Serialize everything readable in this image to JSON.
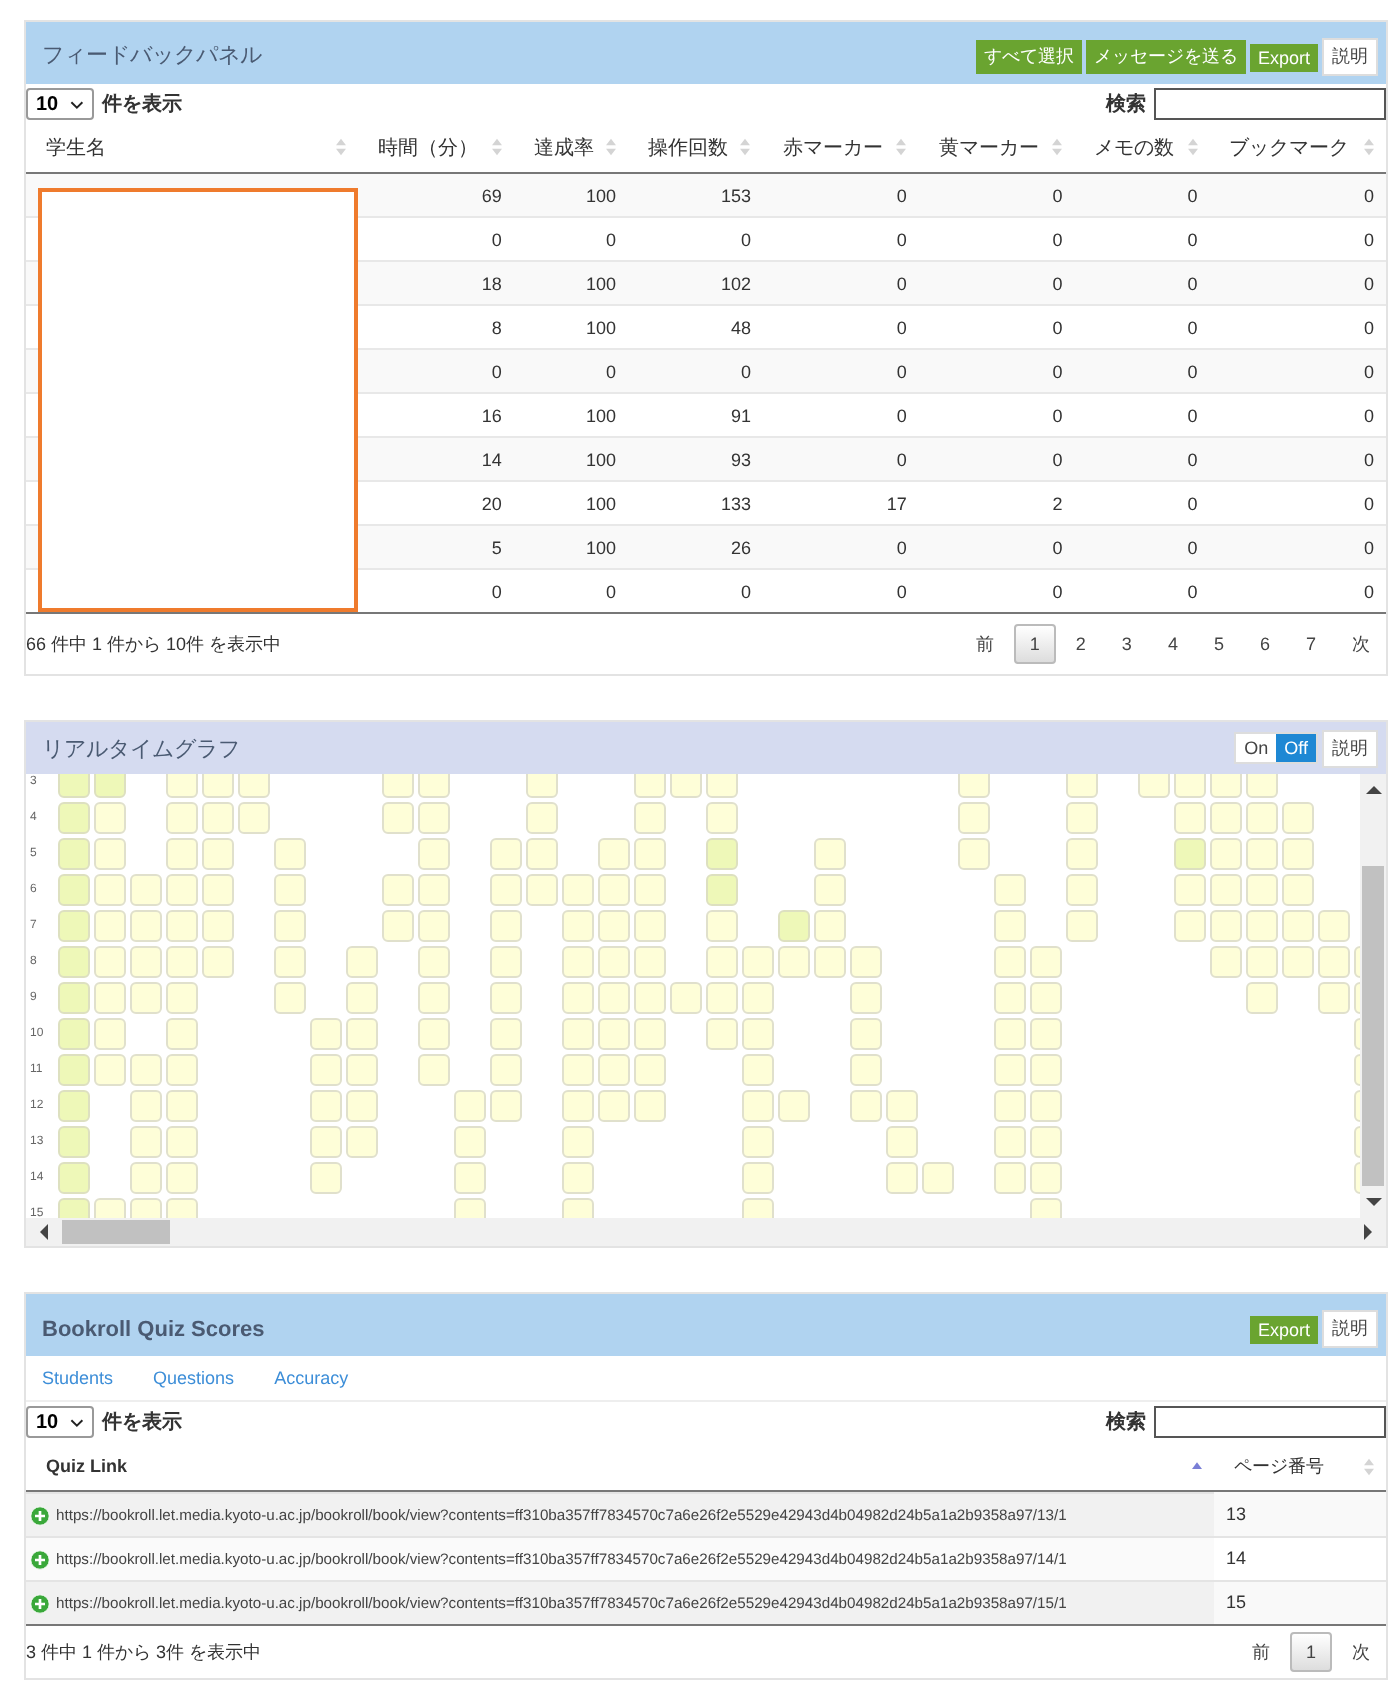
{
  "feedback": {
    "title": "フィードバックパネル",
    "buttons": [
      {
        "label": "すべて選択",
        "kind": "primary"
      },
      {
        "label": "メッセージを送る",
        "kind": "primary"
      },
      {
        "label": "Export",
        "kind": "primary"
      },
      {
        "label": "説明",
        "kind": "plain"
      }
    ],
    "length": {
      "value": "10",
      "label": "件を表示"
    },
    "search": {
      "label": "検索"
    },
    "columns": [
      "学生名",
      "時間（分）",
      "達成率",
      "操作回数",
      "赤マーカー",
      "黄マーカー",
      "メモの数",
      "ブックマーク"
    ],
    "rows": [
      [
        "",
        "69",
        "100",
        "153",
        "0",
        "0",
        "0",
        "0"
      ],
      [
        "",
        "0",
        "0",
        "0",
        "0",
        "0",
        "0",
        "0"
      ],
      [
        "",
        "18",
        "100",
        "102",
        "0",
        "0",
        "0",
        "0"
      ],
      [
        "",
        "8",
        "100",
        "48",
        "0",
        "0",
        "0",
        "0"
      ],
      [
        "",
        "0",
        "0",
        "0",
        "0",
        "0",
        "0",
        "0"
      ],
      [
        "",
        "16",
        "100",
        "91",
        "0",
        "0",
        "0",
        "0"
      ],
      [
        "",
        "14",
        "100",
        "93",
        "0",
        "0",
        "0",
        "0"
      ],
      [
        "",
        "20",
        "100",
        "133",
        "17",
        "2",
        "0",
        "0"
      ],
      [
        "",
        "5",
        "100",
        "26",
        "0",
        "0",
        "0",
        "0"
      ],
      [
        "",
        "0",
        "0",
        "0",
        "0",
        "0",
        "0",
        "0"
      ]
    ],
    "info": "66 件中 1 件から 10件 を表示中",
    "pages": [
      {
        "label": "前",
        "selected": false
      },
      {
        "label": "1",
        "selected": true
      },
      {
        "label": "2",
        "selected": false
      },
      {
        "label": "3",
        "selected": false
      },
      {
        "label": "4",
        "selected": false
      },
      {
        "label": "5",
        "selected": false
      },
      {
        "label": "6",
        "selected": false
      },
      {
        "label": "7",
        "selected": false
      },
      {
        "label": "次",
        "selected": false
      }
    ]
  },
  "graph": {
    "title": "リアルタイムグラフ",
    "toggle": [
      {
        "label": "On",
        "selected": false
      },
      {
        "label": "Off",
        "selected": true
      }
    ],
    "help": "説明",
    "rows": [
      {
        "label": "3",
        "cells": [
          {
            "kind": "lime"
          },
          {
            "kind": "lime"
          },
          {
            "kind": "none"
          },
          {
            "kind": "pale"
          },
          {
            "kind": "pale"
          },
          {
            "kind": "pale"
          },
          {
            "kind": "none"
          },
          {
            "kind": "none"
          },
          {
            "kind": "none"
          },
          {
            "kind": "pale"
          },
          {
            "kind": "pale"
          },
          {
            "kind": "none"
          },
          {
            "kind": "none"
          },
          {
            "kind": "pale"
          },
          {
            "kind": "none"
          },
          {
            "kind": "none"
          },
          {
            "kind": "pale"
          },
          {
            "kind": "pale"
          },
          {
            "kind": "pale"
          },
          {
            "kind": "none"
          },
          {
            "kind": "none"
          },
          {
            "kind": "none"
          },
          {
            "kind": "none"
          },
          {
            "kind": "none"
          },
          {
            "kind": "none"
          },
          {
            "kind": "pale"
          },
          {
            "kind": "none"
          },
          {
            "kind": "none"
          },
          {
            "kind": "pale"
          },
          {
            "kind": "none"
          },
          {
            "kind": "pale"
          },
          {
            "kind": "pale"
          },
          {
            "kind": "pale"
          },
          {
            "kind": "pale"
          },
          {
            "kind": "none"
          },
          {
            "kind": "none"
          },
          {
            "kind": "none"
          }
        ]
      },
      {
        "label": "4",
        "cells": [
          {
            "kind": "lime"
          },
          {
            "kind": "pale"
          },
          {
            "kind": "none"
          },
          {
            "kind": "pale"
          },
          {
            "kind": "pale"
          },
          {
            "kind": "pale"
          },
          {
            "kind": "none"
          },
          {
            "kind": "none"
          },
          {
            "kind": "none"
          },
          {
            "kind": "pale"
          },
          {
            "kind": "pale"
          },
          {
            "kind": "none"
          },
          {
            "kind": "none"
          },
          {
            "kind": "pale"
          },
          {
            "kind": "none"
          },
          {
            "kind": "none"
          },
          {
            "kind": "pale"
          },
          {
            "kind": "none"
          },
          {
            "kind": "pale"
          },
          {
            "kind": "none"
          },
          {
            "kind": "none"
          },
          {
            "kind": "none"
          },
          {
            "kind": "none"
          },
          {
            "kind": "none"
          },
          {
            "kind": "none"
          },
          {
            "kind": "pale"
          },
          {
            "kind": "none"
          },
          {
            "kind": "none"
          },
          {
            "kind": "pale"
          },
          {
            "kind": "none"
          },
          {
            "kind": "none"
          },
          {
            "kind": "pale"
          },
          {
            "kind": "pale"
          },
          {
            "kind": "pale"
          },
          {
            "kind": "pale"
          },
          {
            "kind": "none"
          },
          {
            "kind": "none"
          }
        ]
      },
      {
        "label": "5",
        "cells": [
          {
            "kind": "lime"
          },
          {
            "kind": "pale"
          },
          {
            "kind": "none"
          },
          {
            "kind": "pale"
          },
          {
            "kind": "pale"
          },
          {
            "kind": "none"
          },
          {
            "kind": "pale"
          },
          {
            "kind": "none"
          },
          {
            "kind": "none"
          },
          {
            "kind": "none"
          },
          {
            "kind": "pale"
          },
          {
            "kind": "none"
          },
          {
            "kind": "pale"
          },
          {
            "kind": "pale"
          },
          {
            "kind": "none"
          },
          {
            "kind": "pale"
          },
          {
            "kind": "pale"
          },
          {
            "kind": "none"
          },
          {
            "kind": "lime"
          },
          {
            "kind": "none"
          },
          {
            "kind": "none"
          },
          {
            "kind": "pale"
          },
          {
            "kind": "none"
          },
          {
            "kind": "none"
          },
          {
            "kind": "none"
          },
          {
            "kind": "pale"
          },
          {
            "kind": "none"
          },
          {
            "kind": "none"
          },
          {
            "kind": "pale"
          },
          {
            "kind": "none"
          },
          {
            "kind": "none"
          },
          {
            "kind": "lime"
          },
          {
            "kind": "pale"
          },
          {
            "kind": "pale"
          },
          {
            "kind": "pale"
          },
          {
            "kind": "none"
          },
          {
            "kind": "none"
          }
        ]
      },
      {
        "label": "6",
        "cells": [
          {
            "kind": "lime"
          },
          {
            "kind": "pale"
          },
          {
            "kind": "pale"
          },
          {
            "kind": "pale"
          },
          {
            "kind": "pale"
          },
          {
            "kind": "none"
          },
          {
            "kind": "pale"
          },
          {
            "kind": "none"
          },
          {
            "kind": "none"
          },
          {
            "kind": "pale"
          },
          {
            "kind": "pale"
          },
          {
            "kind": "none"
          },
          {
            "kind": "pale"
          },
          {
            "kind": "pale"
          },
          {
            "kind": "pale"
          },
          {
            "kind": "pale"
          },
          {
            "kind": "pale"
          },
          {
            "kind": "none"
          },
          {
            "kind": "lime"
          },
          {
            "kind": "none"
          },
          {
            "kind": "none"
          },
          {
            "kind": "pale"
          },
          {
            "kind": "none"
          },
          {
            "kind": "none"
          },
          {
            "kind": "none"
          },
          {
            "kind": "none"
          },
          {
            "kind": "pale"
          },
          {
            "kind": "none"
          },
          {
            "kind": "pale"
          },
          {
            "kind": "none"
          },
          {
            "kind": "none"
          },
          {
            "kind": "pale"
          },
          {
            "kind": "pale"
          },
          {
            "kind": "pale"
          },
          {
            "kind": "pale"
          },
          {
            "kind": "none"
          },
          {
            "kind": "none"
          }
        ]
      },
      {
        "label": "7",
        "cells": [
          {
            "kind": "lime"
          },
          {
            "kind": "pale"
          },
          {
            "kind": "pale"
          },
          {
            "kind": "pale"
          },
          {
            "kind": "pale"
          },
          {
            "kind": "none"
          },
          {
            "kind": "pale"
          },
          {
            "kind": "none"
          },
          {
            "kind": "none"
          },
          {
            "kind": "pale"
          },
          {
            "kind": "pale"
          },
          {
            "kind": "none"
          },
          {
            "kind": "pale"
          },
          {
            "kind": "none"
          },
          {
            "kind": "pale"
          },
          {
            "kind": "pale"
          },
          {
            "kind": "pale"
          },
          {
            "kind": "none"
          },
          {
            "kind": "pale"
          },
          {
            "kind": "none"
          },
          {
            "kind": "lime"
          },
          {
            "kind": "pale"
          },
          {
            "kind": "none"
          },
          {
            "kind": "none"
          },
          {
            "kind": "none"
          },
          {
            "kind": "none"
          },
          {
            "kind": "pale"
          },
          {
            "kind": "none"
          },
          {
            "kind": "pale"
          },
          {
            "kind": "none"
          },
          {
            "kind": "none"
          },
          {
            "kind": "pale"
          },
          {
            "kind": "pale"
          },
          {
            "kind": "pale"
          },
          {
            "kind": "pale"
          },
          {
            "kind": "pale"
          },
          {
            "kind": "none"
          }
        ]
      },
      {
        "label": "8",
        "cells": [
          {
            "kind": "lime"
          },
          {
            "kind": "pale"
          },
          {
            "kind": "pale"
          },
          {
            "kind": "pale"
          },
          {
            "kind": "pale"
          },
          {
            "kind": "none"
          },
          {
            "kind": "pale"
          },
          {
            "kind": "none"
          },
          {
            "kind": "pale"
          },
          {
            "kind": "none"
          },
          {
            "kind": "pale"
          },
          {
            "kind": "none"
          },
          {
            "kind": "pale"
          },
          {
            "kind": "none"
          },
          {
            "kind": "pale"
          },
          {
            "kind": "pale"
          },
          {
            "kind": "pale"
          },
          {
            "kind": "none"
          },
          {
            "kind": "pale"
          },
          {
            "kind": "pale"
          },
          {
            "kind": "pale"
          },
          {
            "kind": "pale"
          },
          {
            "kind": "pale"
          },
          {
            "kind": "none"
          },
          {
            "kind": "none"
          },
          {
            "kind": "none"
          },
          {
            "kind": "pale"
          },
          {
            "kind": "pale"
          },
          {
            "kind": "none"
          },
          {
            "kind": "none"
          },
          {
            "kind": "none"
          },
          {
            "kind": "none"
          },
          {
            "kind": "pale"
          },
          {
            "kind": "pale"
          },
          {
            "kind": "pale"
          },
          {
            "kind": "pale"
          },
          {
            "kind": "pale"
          }
        ]
      },
      {
        "label": "9",
        "cells": [
          {
            "kind": "lime"
          },
          {
            "kind": "pale"
          },
          {
            "kind": "pale"
          },
          {
            "kind": "pale"
          },
          {
            "kind": "none"
          },
          {
            "kind": "none"
          },
          {
            "kind": "pale"
          },
          {
            "kind": "none"
          },
          {
            "kind": "pale"
          },
          {
            "kind": "none"
          },
          {
            "kind": "pale"
          },
          {
            "kind": "none"
          },
          {
            "kind": "pale"
          },
          {
            "kind": "none"
          },
          {
            "kind": "pale"
          },
          {
            "kind": "pale"
          },
          {
            "kind": "pale"
          },
          {
            "kind": "pale"
          },
          {
            "kind": "pale"
          },
          {
            "kind": "pale"
          },
          {
            "kind": "none"
          },
          {
            "kind": "none"
          },
          {
            "kind": "pale"
          },
          {
            "kind": "none"
          },
          {
            "kind": "none"
          },
          {
            "kind": "none"
          },
          {
            "kind": "pale"
          },
          {
            "kind": "pale"
          },
          {
            "kind": "none"
          },
          {
            "kind": "none"
          },
          {
            "kind": "none"
          },
          {
            "kind": "none"
          },
          {
            "kind": "none"
          },
          {
            "kind": "pale"
          },
          {
            "kind": "none"
          },
          {
            "kind": "pale"
          },
          {
            "kind": "pale"
          }
        ]
      },
      {
        "label": "10",
        "cells": [
          {
            "kind": "lime"
          },
          {
            "kind": "pale"
          },
          {
            "kind": "none"
          },
          {
            "kind": "pale"
          },
          {
            "kind": "none"
          },
          {
            "kind": "none"
          },
          {
            "kind": "none"
          },
          {
            "kind": "pale"
          },
          {
            "kind": "pale"
          },
          {
            "kind": "none"
          },
          {
            "kind": "pale"
          },
          {
            "kind": "none"
          },
          {
            "kind": "pale"
          },
          {
            "kind": "none"
          },
          {
            "kind": "pale"
          },
          {
            "kind": "pale"
          },
          {
            "kind": "pale"
          },
          {
            "kind": "none"
          },
          {
            "kind": "pale"
          },
          {
            "kind": "pale"
          },
          {
            "kind": "none"
          },
          {
            "kind": "none"
          },
          {
            "kind": "pale"
          },
          {
            "kind": "none"
          },
          {
            "kind": "none"
          },
          {
            "kind": "none"
          },
          {
            "kind": "pale"
          },
          {
            "kind": "pale"
          },
          {
            "kind": "none"
          },
          {
            "kind": "none"
          },
          {
            "kind": "none"
          },
          {
            "kind": "none"
          },
          {
            "kind": "none"
          },
          {
            "kind": "none"
          },
          {
            "kind": "none"
          },
          {
            "kind": "none"
          },
          {
            "kind": "pale"
          }
        ]
      },
      {
        "label": "11",
        "cells": [
          {
            "kind": "lime"
          },
          {
            "kind": "pale"
          },
          {
            "kind": "pale"
          },
          {
            "kind": "pale"
          },
          {
            "kind": "none"
          },
          {
            "kind": "none"
          },
          {
            "kind": "none"
          },
          {
            "kind": "pale"
          },
          {
            "kind": "pale"
          },
          {
            "kind": "none"
          },
          {
            "kind": "pale"
          },
          {
            "kind": "none"
          },
          {
            "kind": "pale"
          },
          {
            "kind": "none"
          },
          {
            "kind": "pale"
          },
          {
            "kind": "pale"
          },
          {
            "kind": "pale"
          },
          {
            "kind": "none"
          },
          {
            "kind": "none"
          },
          {
            "kind": "pale"
          },
          {
            "kind": "none"
          },
          {
            "kind": "none"
          },
          {
            "kind": "pale"
          },
          {
            "kind": "none"
          },
          {
            "kind": "none"
          },
          {
            "kind": "none"
          },
          {
            "kind": "pale"
          },
          {
            "kind": "pale"
          },
          {
            "kind": "none"
          },
          {
            "kind": "none"
          },
          {
            "kind": "none"
          },
          {
            "kind": "none"
          },
          {
            "kind": "none"
          },
          {
            "kind": "none"
          },
          {
            "kind": "none"
          },
          {
            "kind": "none"
          },
          {
            "kind": "pale"
          }
        ]
      },
      {
        "label": "12",
        "cells": [
          {
            "kind": "lime"
          },
          {
            "kind": "none"
          },
          {
            "kind": "pale"
          },
          {
            "kind": "pale"
          },
          {
            "kind": "none"
          },
          {
            "kind": "none"
          },
          {
            "kind": "none"
          },
          {
            "kind": "pale"
          },
          {
            "kind": "pale"
          },
          {
            "kind": "none"
          },
          {
            "kind": "none"
          },
          {
            "kind": "pale"
          },
          {
            "kind": "pale"
          },
          {
            "kind": "none"
          },
          {
            "kind": "pale"
          },
          {
            "kind": "pale"
          },
          {
            "kind": "pale"
          },
          {
            "kind": "none"
          },
          {
            "kind": "none"
          },
          {
            "kind": "pale"
          },
          {
            "kind": "pale"
          },
          {
            "kind": "none"
          },
          {
            "kind": "pale"
          },
          {
            "kind": "pale"
          },
          {
            "kind": "none"
          },
          {
            "kind": "none"
          },
          {
            "kind": "pale"
          },
          {
            "kind": "pale"
          },
          {
            "kind": "none"
          },
          {
            "kind": "none"
          },
          {
            "kind": "none"
          },
          {
            "kind": "none"
          },
          {
            "kind": "none"
          },
          {
            "kind": "none"
          },
          {
            "kind": "none"
          },
          {
            "kind": "none"
          },
          {
            "kind": "pale"
          }
        ]
      },
      {
        "label": "13",
        "cells": [
          {
            "kind": "lime"
          },
          {
            "kind": "none"
          },
          {
            "kind": "pale"
          },
          {
            "kind": "pale"
          },
          {
            "kind": "none"
          },
          {
            "kind": "none"
          },
          {
            "kind": "none"
          },
          {
            "kind": "pale"
          },
          {
            "kind": "pale"
          },
          {
            "kind": "none"
          },
          {
            "kind": "none"
          },
          {
            "kind": "pale"
          },
          {
            "kind": "none"
          },
          {
            "kind": "none"
          },
          {
            "kind": "pale"
          },
          {
            "kind": "none"
          },
          {
            "kind": "none"
          },
          {
            "kind": "none"
          },
          {
            "kind": "none"
          },
          {
            "kind": "pale"
          },
          {
            "kind": "none"
          },
          {
            "kind": "none"
          },
          {
            "kind": "none"
          },
          {
            "kind": "pale"
          },
          {
            "kind": "none"
          },
          {
            "kind": "none"
          },
          {
            "kind": "pale"
          },
          {
            "kind": "pale"
          },
          {
            "kind": "none"
          },
          {
            "kind": "none"
          },
          {
            "kind": "none"
          },
          {
            "kind": "none"
          },
          {
            "kind": "none"
          },
          {
            "kind": "none"
          },
          {
            "kind": "none"
          },
          {
            "kind": "none"
          },
          {
            "kind": "pale"
          }
        ]
      },
      {
        "label": "14",
        "cells": [
          {
            "kind": "lime"
          },
          {
            "kind": "none"
          },
          {
            "kind": "pale"
          },
          {
            "kind": "pale"
          },
          {
            "kind": "none"
          },
          {
            "kind": "none"
          },
          {
            "kind": "none"
          },
          {
            "kind": "pale"
          },
          {
            "kind": "none"
          },
          {
            "kind": "none"
          },
          {
            "kind": "none"
          },
          {
            "kind": "pale"
          },
          {
            "kind": "none"
          },
          {
            "kind": "none"
          },
          {
            "kind": "pale"
          },
          {
            "kind": "none"
          },
          {
            "kind": "none"
          },
          {
            "kind": "none"
          },
          {
            "kind": "none"
          },
          {
            "kind": "pale"
          },
          {
            "kind": "none"
          },
          {
            "kind": "none"
          },
          {
            "kind": "none"
          },
          {
            "kind": "pale"
          },
          {
            "kind": "pale"
          },
          {
            "kind": "none"
          },
          {
            "kind": "pale"
          },
          {
            "kind": "pale"
          },
          {
            "kind": "none"
          },
          {
            "kind": "none"
          },
          {
            "kind": "none"
          },
          {
            "kind": "none"
          },
          {
            "kind": "none"
          },
          {
            "kind": "none"
          },
          {
            "kind": "none"
          },
          {
            "kind": "none"
          },
          {
            "kind": "pale"
          }
        ]
      },
      {
        "label": "15",
        "cells": [
          {
            "kind": "lime"
          },
          {
            "kind": "pale"
          },
          {
            "kind": "pale"
          },
          {
            "kind": "pale"
          },
          {
            "kind": "none"
          },
          {
            "kind": "none"
          },
          {
            "kind": "none"
          },
          {
            "kind": "none"
          },
          {
            "kind": "none"
          },
          {
            "kind": "none"
          },
          {
            "kind": "none"
          },
          {
            "kind": "pale"
          },
          {
            "kind": "none"
          },
          {
            "kind": "none"
          },
          {
            "kind": "pale"
          },
          {
            "kind": "none"
          },
          {
            "kind": "none"
          },
          {
            "kind": "none"
          },
          {
            "kind": "none"
          },
          {
            "kind": "pale"
          },
          {
            "kind": "none"
          },
          {
            "kind": "none"
          },
          {
            "kind": "none"
          },
          {
            "kind": "none"
          },
          {
            "kind": "none"
          },
          {
            "kind": "none"
          },
          {
            "kind": "none"
          },
          {
            "kind": "pale"
          },
          {
            "kind": "none"
          },
          {
            "kind": "none"
          },
          {
            "kind": "none"
          },
          {
            "kind": "none"
          },
          {
            "kind": "none"
          },
          {
            "kind": "none"
          },
          {
            "kind": "none"
          },
          {
            "kind": "none"
          },
          {
            "kind": "none"
          }
        ]
      }
    ]
  },
  "quiz": {
    "title": "Bookroll Quiz Scores",
    "buttons": [
      {
        "label": "Export",
        "kind": "primary"
      },
      {
        "label": "説明",
        "kind": "plain"
      }
    ],
    "tabs": [
      "Students",
      "Questions",
      "Accuracy"
    ],
    "length": {
      "value": "10",
      "label": "件を表示"
    },
    "search": {
      "label": "検索"
    },
    "columns": [
      {
        "label": "Quiz Link",
        "sorted": true
      },
      {
        "label": "ページ番号",
        "sorted": false
      }
    ],
    "rows": [
      {
        "link": "https://bookroll.let.media.kyoto-u.ac.jp/bookroll/book/view?contents=ff310ba357ff7834570c7a6e26f2e5529e42943d4b04982d24b5a1a2b9358a97/13/1",
        "page": "13"
      },
      {
        "link": "https://bookroll.let.media.kyoto-u.ac.jp/bookroll/book/view?contents=ff310ba357ff7834570c7a6e26f2e5529e42943d4b04982d24b5a1a2b9358a97/14/1",
        "page": "14"
      },
      {
        "link": "https://bookroll.let.media.kyoto-u.ac.jp/bookroll/book/view?contents=ff310ba357ff7834570c7a6e26f2e5529e42943d4b04982d24b5a1a2b9358a97/15/1",
        "page": "15"
      }
    ],
    "info": "3 件中 1 件から 3件 を表示中",
    "pages": [
      {
        "label": "前",
        "selected": false
      },
      {
        "label": "1",
        "selected": true
      },
      {
        "label": "次",
        "selected": false
      }
    ]
  }
}
